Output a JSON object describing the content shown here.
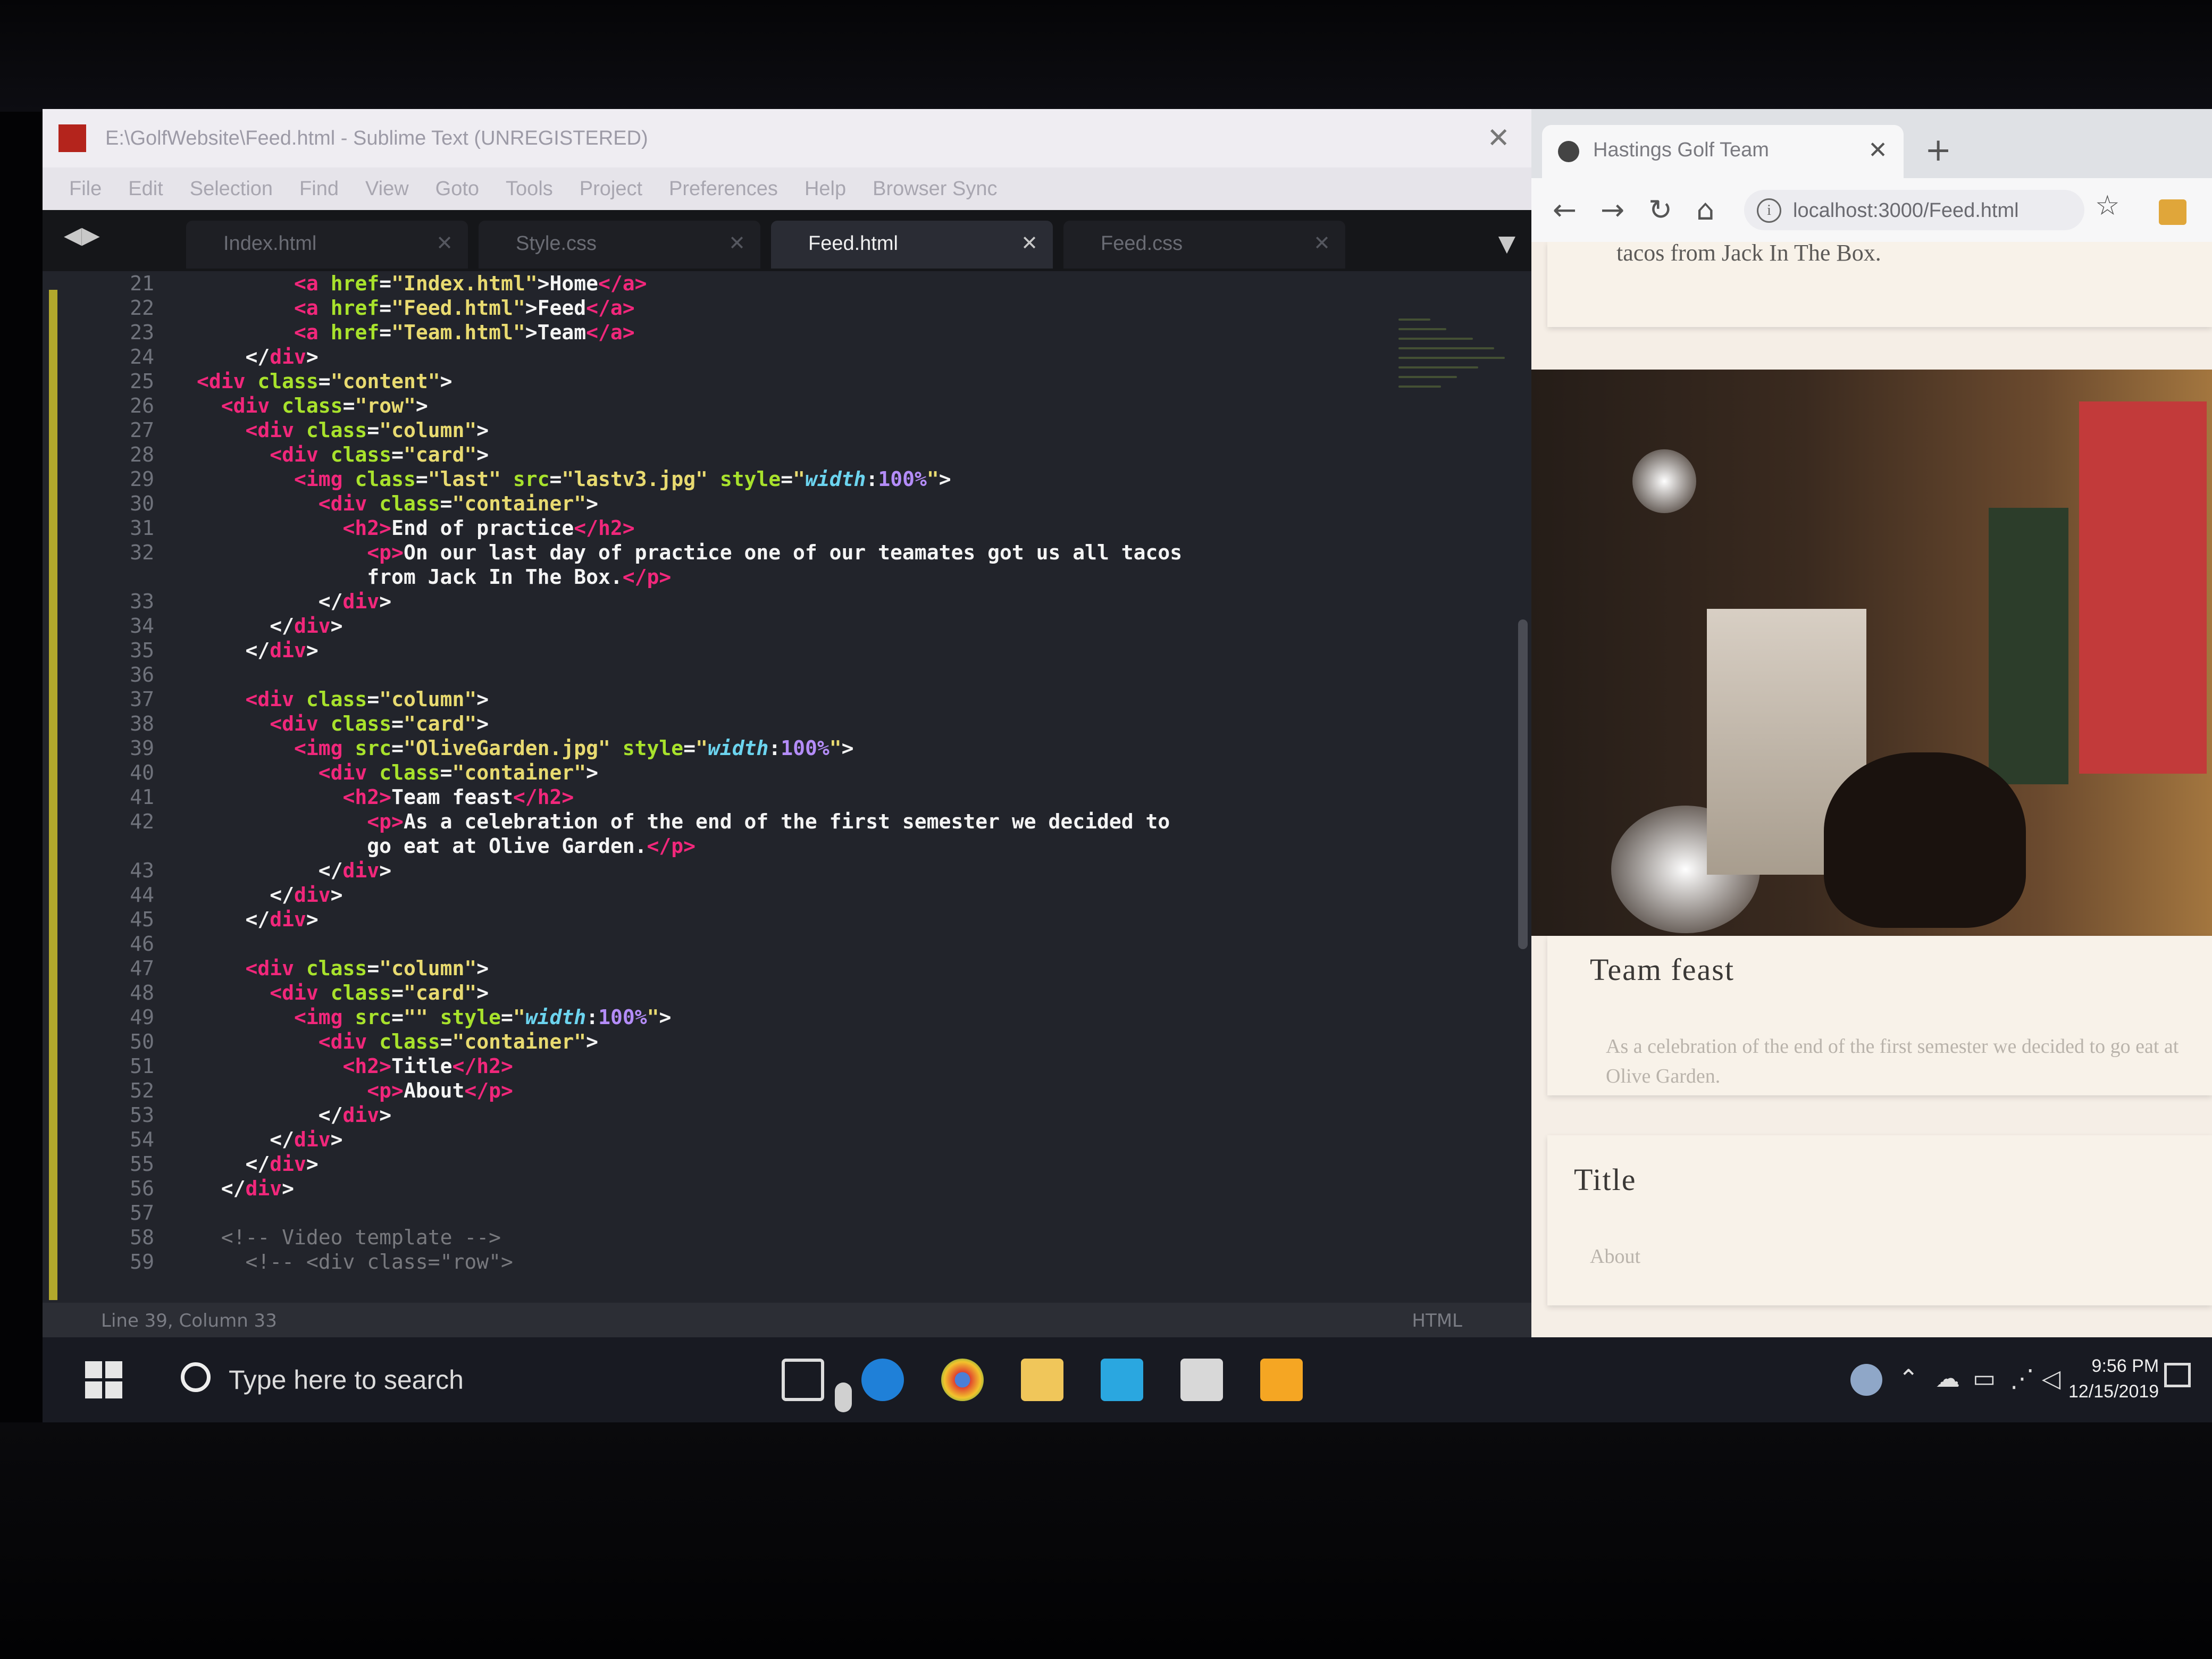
{
  "editor": {
    "window_title": "E:\\GolfWebsite\\Feed.html - Sublime Text (UNREGISTERED)",
    "menu": [
      "File",
      "Edit",
      "Selection",
      "Find",
      "View",
      "Goto",
      "Tools",
      "Project",
      "Preferences",
      "Help",
      "Browser Sync"
    ],
    "tabs": [
      {
        "label": "Index.html",
        "active": false
      },
      {
        "label": "Style.css",
        "active": false
      },
      {
        "label": "Feed.html",
        "active": true
      },
      {
        "label": "Feed.css",
        "active": false
      }
    ],
    "code_lines": [
      {
        "n": "21",
        "html": "        <span class=\"tag\">&lt;a</span> <span class=\"attr\">href</span>=<span class=\"str\">\"Index.html\"</span>&gt;Home<span class=\"tag\">&lt;/a&gt;</span>"
      },
      {
        "n": "22",
        "html": "        <span class=\"tag\">&lt;a</span> <span class=\"attr\">href</span>=<span class=\"str\">\"Feed.html\"</span>&gt;Feed<span class=\"tag\">&lt;/a&gt;</span>"
      },
      {
        "n": "23",
        "html": "        <span class=\"tag\">&lt;a</span> <span class=\"attr\">href</span>=<span class=\"str\">\"Team.html\"</span>&gt;Team<span class=\"tag\">&lt;/a&gt;</span>"
      },
      {
        "n": "24",
        "html": "    &lt;/<span class=\"tag\">div</span>&gt;"
      },
      {
        "n": "25",
        "html": "<span class=\"tag\">&lt;div</span> <span class=\"attr\">class</span>=<span class=\"str\">\"content\"</span>&gt;"
      },
      {
        "n": "26",
        "html": "  <span class=\"tag\">&lt;div</span> <span class=\"attr\">class</span>=<span class=\"str\">\"row\"</span>&gt;"
      },
      {
        "n": "27",
        "html": "    <span class=\"tag\">&lt;div</span> <span class=\"attr\">class</span>=<span class=\"str\">\"column\"</span>&gt;"
      },
      {
        "n": "28",
        "html": "      <span class=\"tag\">&lt;div</span> <span class=\"attr\">class</span>=<span class=\"str\">\"card\"</span>&gt;"
      },
      {
        "n": "29",
        "html": "        <span class=\"tag\">&lt;img</span> <span class=\"attr\">class</span>=<span class=\"str\">\"last\"</span> <span class=\"attr\">src</span>=<span class=\"str\">\"lastv3.jpg\"</span> <span class=\"attr\">style</span>=<span class=\"str\">\"</span><span class=\"kw\">width</span>:<span class=\"num\">100%</span><span class=\"str\">\"</span>&gt;"
      },
      {
        "n": "30",
        "html": "          <span class=\"tag\">&lt;div</span> <span class=\"attr\">class</span>=<span class=\"str\">\"container\"</span>&gt;"
      },
      {
        "n": "31",
        "html": "            <span class=\"tag\">&lt;h2&gt;</span>End of practice<span class=\"tag\">&lt;/h2&gt;</span>"
      },
      {
        "n": "32",
        "html": "              <span class=\"tag\">&lt;p&gt;</span>On our last day of practice one of our teamates got us all tacos"
      },
      {
        "n": "",
        "html": "              from Jack In The Box.<span class=\"tag\">&lt;/p&gt;</span>"
      },
      {
        "n": "33",
        "html": "          &lt;/<span class=\"tag\">div</span>&gt;"
      },
      {
        "n": "34",
        "html": "      &lt;/<span class=\"tag\">div</span>&gt;"
      },
      {
        "n": "35",
        "html": "    &lt;/<span class=\"tag\">div</span>&gt;"
      },
      {
        "n": "36",
        "html": ""
      },
      {
        "n": "37",
        "html": "    <span class=\"tag\">&lt;div</span> <span class=\"attr\">class</span>=<span class=\"str\">\"column\"</span>&gt;"
      },
      {
        "n": "38",
        "html": "      <span class=\"tag\">&lt;div</span> <span class=\"attr\">class</span>=<span class=\"str\">\"card\"</span>&gt;"
      },
      {
        "n": "39",
        "html": "        <span class=\"tag\">&lt;img</span> <span class=\"attr\">src</span>=<span class=\"str\">\"OliveGarden.jpg\"</span> <span class=\"attr\">style</span>=<span class=\"str\">\"</span><span class=\"kw\">width</span>:<span class=\"num\">100%</span><span class=\"str\">\"</span>&gt;"
      },
      {
        "n": "40",
        "html": "          <span class=\"tag\">&lt;div</span> <span class=\"attr\">class</span>=<span class=\"str\">\"container\"</span>&gt;"
      },
      {
        "n": "41",
        "html": "            <span class=\"tag\">&lt;h2&gt;</span>Team feast<span class=\"tag\">&lt;/h2&gt;</span>"
      },
      {
        "n": "42",
        "html": "              <span class=\"tag\">&lt;p&gt;</span>As a celebration of the end of the first semester we decided to"
      },
      {
        "n": "",
        "html": "              go eat at Olive Garden.<span class=\"tag\">&lt;/p&gt;</span>"
      },
      {
        "n": "43",
        "html": "          &lt;/<span class=\"tag\">div</span>&gt;"
      },
      {
        "n": "44",
        "html": "      &lt;/<span class=\"tag\">div</span>&gt;"
      },
      {
        "n": "45",
        "html": "    &lt;/<span class=\"tag\">div</span>&gt;"
      },
      {
        "n": "46",
        "html": ""
      },
      {
        "n": "47",
        "html": "    <span class=\"tag\">&lt;div</span> <span class=\"attr\">class</span>=<span class=\"str\">\"column\"</span>&gt;"
      },
      {
        "n": "48",
        "html": "      <span class=\"tag\">&lt;div</span> <span class=\"attr\">class</span>=<span class=\"str\">\"card\"</span>&gt;"
      },
      {
        "n": "49",
        "html": "        <span class=\"tag\">&lt;img</span> <span class=\"attr\">src</span>=<span class=\"str\">\"\"</span> <span class=\"attr\">style</span>=<span class=\"str\">\"</span><span class=\"kw\">width</span>:<span class=\"num\">100%</span><span class=\"str\">\"</span>&gt;"
      },
      {
        "n": "50",
        "html": "          <span class=\"tag\">&lt;div</span> <span class=\"attr\">class</span>=<span class=\"str\">\"container\"</span>&gt;"
      },
      {
        "n": "51",
        "html": "            <span class=\"tag\">&lt;h2&gt;</span>Title<span class=\"tag\">&lt;/h2&gt;</span>"
      },
      {
        "n": "52",
        "html": "              <span class=\"tag\">&lt;p&gt;</span>About<span class=\"tag\">&lt;/p&gt;</span>"
      },
      {
        "n": "53",
        "html": "          &lt;/<span class=\"tag\">div</span>&gt;"
      },
      {
        "n": "54",
        "html": "      &lt;/<span class=\"tag\">div</span>&gt;"
      },
      {
        "n": "55",
        "html": "    &lt;/<span class=\"tag\">div</span>&gt;"
      },
      {
        "n": "56",
        "html": "  &lt;/<span class=\"tag\">div</span>&gt;"
      },
      {
        "n": "57",
        "html": ""
      },
      {
        "n": "58",
        "html": "  <span class=\"cmt\">&lt;!-- Video template --&gt;</span>"
      },
      {
        "n": "59",
        "html": "    <span class=\"cmt\">&lt;!-- &lt;div class=\"row\"&gt;</span>"
      }
    ],
    "status": "Line 39, Column 33",
    "syntax": "HTML"
  },
  "browser": {
    "tab_title": "Hastings Golf Team",
    "url": "localhost:3000/Feed.html",
    "card1_text_tail": "tacos from Jack In The Box.",
    "card2_title": "Team feast",
    "card2_body": "As a celebration of the end of the first semester we decided to go eat at Olive Garden.",
    "card3_title": "Title",
    "card3_body": "About"
  },
  "taskbar": {
    "search_placeholder": "Type here to search",
    "time": "9:56 PM",
    "date": "12/15/2019"
  },
  "colors": {
    "tag": "#f1277b",
    "attr": "#a8e22c",
    "string": "#e8da70",
    "editor_bg": "#22242b",
    "page_bg": "#f5eee6"
  }
}
